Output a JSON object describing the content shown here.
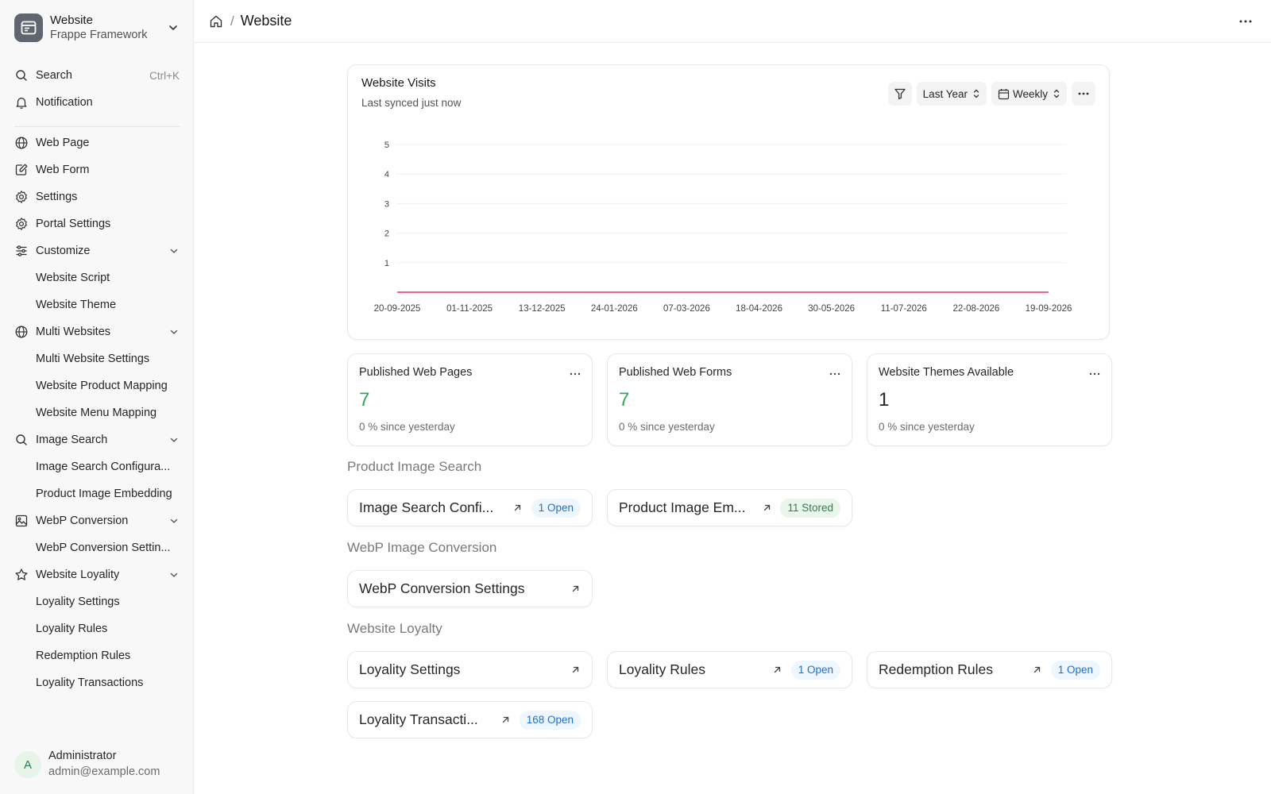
{
  "app": {
    "name": "Website",
    "subtitle": "Frappe Framework"
  },
  "nav_top": [
    {
      "name": "search",
      "icon": "search-icon",
      "label": "Search",
      "shortcut": "Ctrl+K"
    },
    {
      "name": "notification",
      "icon": "bell-icon",
      "label": "Notification"
    }
  ],
  "nav": [
    {
      "name": "web-page",
      "icon": "globe-icon",
      "label": "Web Page"
    },
    {
      "name": "web-form",
      "icon": "form-edit-icon",
      "label": "Web Form"
    },
    {
      "name": "settings",
      "icon": "gear-icon",
      "label": "Settings"
    },
    {
      "name": "portal-settings",
      "icon": "gear-icon",
      "label": "Portal Settings"
    },
    {
      "name": "customize",
      "icon": "sliders-icon",
      "label": "Customize",
      "expandable": true
    },
    {
      "name": "website-script",
      "label": "Website Script",
      "sub": true
    },
    {
      "name": "website-theme",
      "label": "Website Theme",
      "sub": true
    },
    {
      "name": "multi-websites",
      "icon": "globe-icon",
      "label": "Multi Websites",
      "expandable": true
    },
    {
      "name": "multi-website-settings",
      "label": "Multi Website Settings",
      "sub": true
    },
    {
      "name": "website-product-mapping",
      "label": "Website Product Mapping",
      "sub": true
    },
    {
      "name": "website-menu-mapping",
      "label": "Website Menu Mapping",
      "sub": true
    },
    {
      "name": "image-search",
      "icon": "search-icon",
      "label": "Image Search",
      "expandable": true
    },
    {
      "name": "image-search-configuration",
      "label": "Image Search Configura...",
      "sub": true
    },
    {
      "name": "product-image-embedding",
      "label": "Product Image Embedding",
      "sub": true
    },
    {
      "name": "webp-conversion",
      "icon": "image-icon",
      "label": "WebP Conversion",
      "expandable": true
    },
    {
      "name": "webp-conversion-settings",
      "label": "WebP Conversion Settin...",
      "sub": true
    },
    {
      "name": "website-loyality",
      "icon": "star-icon",
      "label": "Website Loyality",
      "expandable": true
    },
    {
      "name": "loyality-settings",
      "label": "Loyality Settings",
      "sub": true
    },
    {
      "name": "loyality-rules",
      "label": "Loyality Rules",
      "sub": true
    },
    {
      "name": "redemption-rules",
      "label": "Redemption Rules",
      "sub": true
    },
    {
      "name": "loyality-transactions",
      "label": "Loyality Transactions",
      "sub": true
    }
  ],
  "user": {
    "initial": "A",
    "name": "Administrator",
    "email": "admin@example.com"
  },
  "header": {
    "title": "Website",
    "separator": "/"
  },
  "chart_card": {
    "title": "Website Visits",
    "subtitle": "Last synced just now",
    "range_label": "Last Year",
    "interval_label": "Weekly"
  },
  "chart_data": {
    "type": "line",
    "title": "Website Visits",
    "x": [
      "20-09-2025",
      "01-11-2025",
      "13-12-2025",
      "24-01-2026",
      "07-03-2026",
      "18-04-2026",
      "30-05-2026",
      "11-07-2026",
      "22-08-2026",
      "19-09-2026"
    ],
    "series": [
      {
        "values": [
          0,
          0,
          0,
          0,
          0,
          0,
          0,
          0,
          0,
          0
        ]
      }
    ],
    "yticks": [
      1,
      2,
      3,
      4,
      5
    ],
    "ylim": [
      0,
      5
    ],
    "grid": true,
    "line_color": "#f0648a"
  },
  "stats": [
    {
      "name": "published-web-pages",
      "title": "Published Web Pages",
      "value": "7",
      "delta": "0 % since yesterday",
      "color": "#30a65a"
    },
    {
      "name": "published-web-forms",
      "title": "Published Web Forms",
      "value": "7",
      "delta": "0 % since yesterday",
      "color": "#30a65a"
    },
    {
      "name": "website-themes-available",
      "title": "Website Themes Available",
      "value": "1",
      "delta": "0 % since yesterday",
      "color": "#262626"
    }
  ],
  "sections": {
    "product_image_search": {
      "title": "Product Image Search",
      "links": [
        {
          "name": "image-search-config",
          "label": "Image Search Confi...",
          "badge": "1 Open",
          "badge_color": "blue"
        },
        {
          "name": "product-image-embedding",
          "label": "Product Image Em...",
          "badge": "11 Stored",
          "badge_color": "green"
        }
      ]
    },
    "webp_image_conversion": {
      "title": "WebP Image Conversion",
      "links": [
        {
          "name": "webp-conversion-settings",
          "label": "WebP Conversion Settings"
        }
      ]
    },
    "website_loyalty": {
      "title": "Website Loyalty",
      "links": [
        {
          "name": "loyality-settings",
          "label": "Loyality Settings"
        },
        {
          "name": "loyality-rules",
          "label": "Loyality Rules",
          "badge": "1 Open",
          "badge_color": "blue"
        },
        {
          "name": "redemption-rules",
          "label": "Redemption Rules",
          "badge": "1 Open",
          "badge_color": "blue"
        },
        {
          "name": "loyality-transactions",
          "label": "Loyality Transacti...",
          "badge": "168 Open",
          "badge_color": "blue"
        }
      ]
    }
  }
}
